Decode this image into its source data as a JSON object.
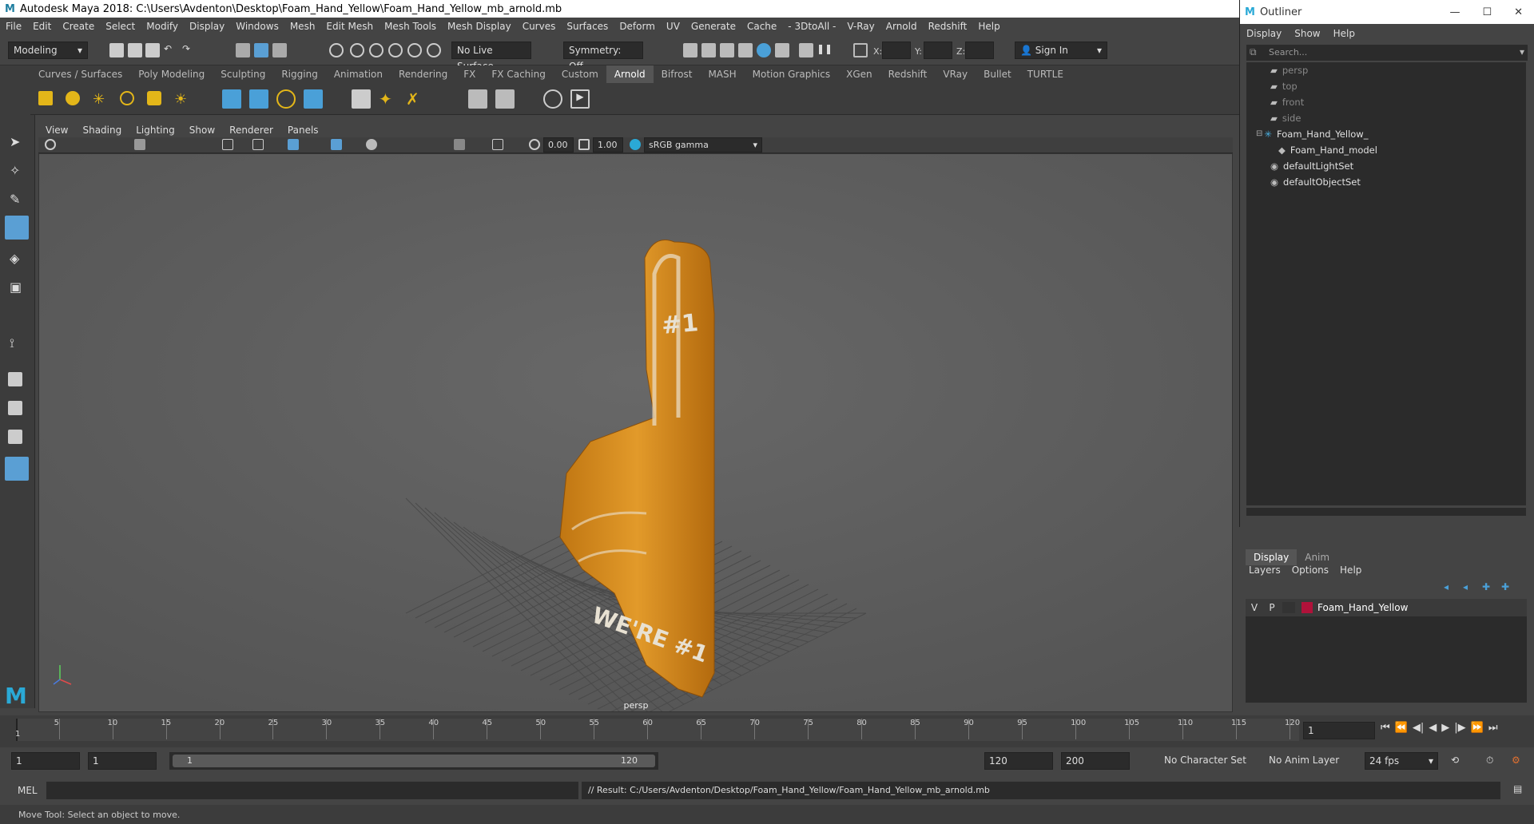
{
  "window": {
    "title": "Autodesk Maya 2018: C:\\Users\\Avdenton\\Desktop\\Foam_Hand_Yellow\\Foam_Hand_Yellow_mb_arnold.mb"
  },
  "menu": [
    "File",
    "Edit",
    "Create",
    "Select",
    "Modify",
    "Display",
    "Windows",
    "Mesh",
    "Edit Mesh",
    "Mesh Tools",
    "Mesh Display",
    "Curves",
    "Surfaces",
    "Deform",
    "UV",
    "Generate",
    "Cache",
    "- 3DtoAll -",
    "V-Ray",
    "Arnold",
    "Redshift",
    "Help"
  ],
  "status": {
    "mode": "Modeling",
    "live_surface": "No Live Surface",
    "symmetry": "Symmetry: Off",
    "x": "X:",
    "y": "Y:",
    "z": "Z:",
    "sign_in": "Sign In"
  },
  "shelf_tabs": [
    "Curves / Surfaces",
    "Poly Modeling",
    "Sculpting",
    "Rigging",
    "Animation",
    "Rendering",
    "FX",
    "FX Caching",
    "Custom",
    "Arnold",
    "Bifrost",
    "MASH",
    "Motion Graphics",
    "XGen",
    "Redshift",
    "VRay",
    "Bullet",
    "TURTLE"
  ],
  "shelf_active": "Arnold",
  "viewport": {
    "menu": [
      "View",
      "Shading",
      "Lighting",
      "Show",
      "Renderer",
      "Panels"
    ],
    "exposure": "0.00",
    "gamma": "1.00",
    "colorspace": "sRGB gamma",
    "camera": "persp"
  },
  "model_text": {
    "top": "#1",
    "bottom": "WE'RE #1"
  },
  "timeline": {
    "ticks": [
      "5",
      "10",
      "15",
      "20",
      "25",
      "30",
      "35",
      "40",
      "45",
      "50",
      "55",
      "60",
      "65",
      "70",
      "75",
      "80",
      "85",
      "90",
      "95",
      "100",
      "105",
      "110",
      "115",
      "120"
    ],
    "start_tick": "1",
    "current_frame": "1"
  },
  "range": {
    "start": "1",
    "current": "1",
    "slider_start": "1",
    "slider_end": "120",
    "end": "120",
    "max": "200",
    "char_set": "No Character Set",
    "anim_layer": "No Anim Layer",
    "fps": "24 fps"
  },
  "cmd": {
    "lang": "MEL",
    "result": "// Result: C:/Users/Avdenton/Desktop/Foam_Hand_Yellow/Foam_Hand_Yellow_mb_arnold.mb"
  },
  "help": "Move Tool: Select an object to move.",
  "outliner": {
    "title": "Outliner",
    "menu": [
      "Display",
      "Show",
      "Help"
    ],
    "search_placeholder": "Search...",
    "items": [
      {
        "label": "persp",
        "type": "camera",
        "indent": 0
      },
      {
        "label": "top",
        "type": "camera",
        "indent": 0
      },
      {
        "label": "front",
        "type": "camera",
        "indent": 0
      },
      {
        "label": "side",
        "type": "camera",
        "indent": 0
      },
      {
        "label": "Foam_Hand_Yellow_",
        "type": "group",
        "indent": 0
      },
      {
        "label": "Foam_Hand_model",
        "type": "mesh",
        "indent": 1
      },
      {
        "label": "defaultLightSet",
        "type": "set",
        "indent": 0
      },
      {
        "label": "defaultObjectSet",
        "type": "set",
        "indent": 0
      }
    ]
  },
  "layers": {
    "tabs": [
      "Display",
      "Anim"
    ],
    "menu": [
      "Layers",
      "Options",
      "Help"
    ],
    "row": {
      "v": "V",
      "p": "P",
      "name": "Foam_Hand_Yellow",
      "color": "#b0123a"
    }
  },
  "colors": {
    "accent": "#5a9fd4",
    "model": "#d4881a",
    "bg": "#444444"
  }
}
